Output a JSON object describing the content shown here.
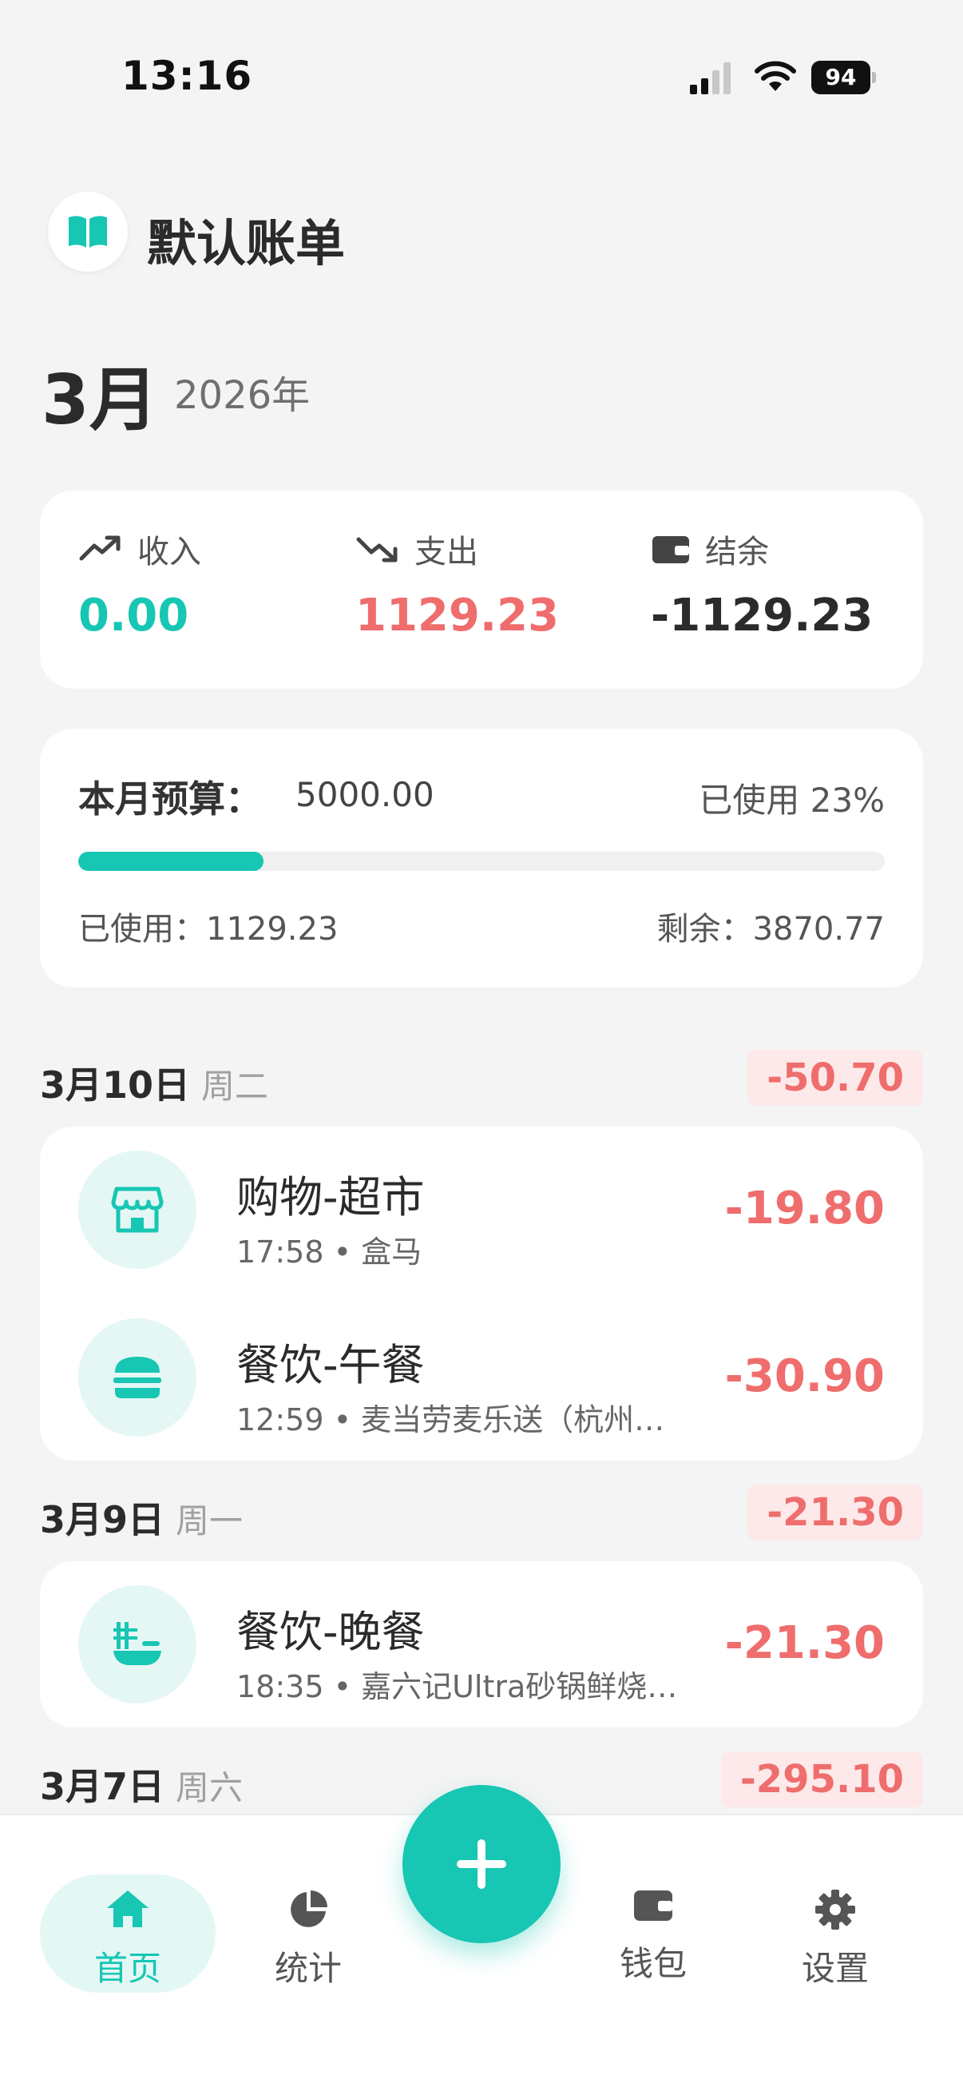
{
  "status_bar": {
    "time": "13:16",
    "battery": "94"
  },
  "header": {
    "ledger_name": "默认账单",
    "month": "3月",
    "year": "2026年"
  },
  "summary": {
    "income_label": "收入",
    "income_value": "0.00",
    "expense_label": "支出",
    "expense_value": "1129.23",
    "balance_label": "结余",
    "balance_value": "-1129.23"
  },
  "budget": {
    "label": "本月预算：",
    "amount": "5000.00",
    "used_pct_text": "已使用 23%",
    "used_fraction": 0.23,
    "used_text": "已使用：1129.23",
    "remain_text": "剩余：3870.77"
  },
  "days": [
    {
      "date": "3月10日",
      "weekday": "周二",
      "total": "-50.70",
      "transactions": [
        {
          "icon": "store-icon",
          "title": "购物-超市",
          "sub": "17:58 • 盒马",
          "amount": "-19.80"
        },
        {
          "icon": "burger-icon",
          "title": "餐饮-午餐",
          "sub": "12:59 • 麦当劳麦乐送（杭州…",
          "amount": "-30.90"
        }
      ]
    },
    {
      "date": "3月9日",
      "weekday": "周一",
      "total": "-21.30",
      "transactions": [
        {
          "icon": "noodles-icon",
          "title": "餐饮-晚餐",
          "sub": "18:35 • 嘉六记Ultra砂锅鲜烧…",
          "amount": "-21.30"
        }
      ]
    },
    {
      "date": "3月7日",
      "weekday": "周六",
      "total": "-295.10",
      "transactions": []
    }
  ],
  "nav": {
    "home": "首页",
    "stats": "统计",
    "wallet": "钱包",
    "settings": "设置"
  },
  "colors": {
    "accent": "#17c6b3",
    "expense": "#ef6d6d",
    "background": "#f4f4f4"
  }
}
